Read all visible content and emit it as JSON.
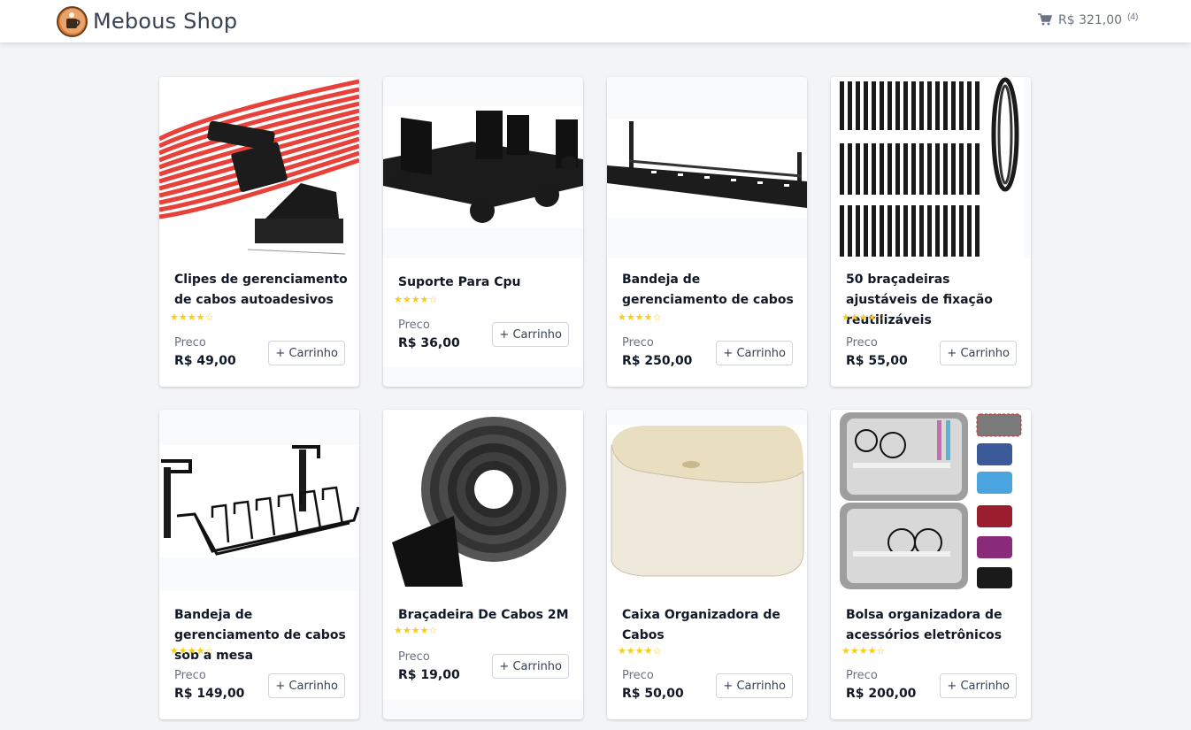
{
  "shop": {
    "name": "Mebous Shop",
    "cart_total": "R$ 321,00",
    "cart_count": "(4)",
    "cart_icon": "cart-icon",
    "logo_icon": "coffee-logo-icon"
  },
  "labels": {
    "price": "Preco",
    "add_to_cart": "+ Carrinho"
  },
  "colors": {
    "star": "#facc15",
    "background": "#f3f4f6"
  },
  "products": [
    {
      "title": "Clipes de gerenciamento de cabos autoadesivos",
      "rating": "★★★★☆",
      "price": "R$ 49,00",
      "image": "red-cables-clip-image"
    },
    {
      "title": "Suporte Para Cpu",
      "rating": "★★★★☆",
      "price": "R$ 36,00",
      "image": "cpu-stand-image"
    },
    {
      "title": "Bandeja de gerenciamento de cabos",
      "rating": "★★★★☆",
      "price": "R$ 250,00",
      "image": "cable-tray-image"
    },
    {
      "title": "50 braçadeiras ajustáveis de fixação reutilizáveis",
      "rating": "★★★★☆",
      "price": "R$ 55,00",
      "image": "velcro-straps-image"
    },
    {
      "title": "Bandeja de gerenciamento de cabos sob a mesa",
      "rating": "★★★★☆",
      "price": "R$ 149,00",
      "image": "desk-cable-basket-image"
    },
    {
      "title": "Braçadeira De Cabos 2M",
      "rating": "★★★★☆",
      "price": "R$ 19,00",
      "image": "velcro-roll-image"
    },
    {
      "title": "Caixa Organizadora de Cabos",
      "rating": "★★★★☆",
      "price": "R$ 50,00",
      "image": "cable-box-image"
    },
    {
      "title": "Bolsa organizadora de acessórios eletrônicos",
      "rating": "★★★★☆",
      "price": "R$ 200,00",
      "image": "electronics-bag-image"
    }
  ]
}
